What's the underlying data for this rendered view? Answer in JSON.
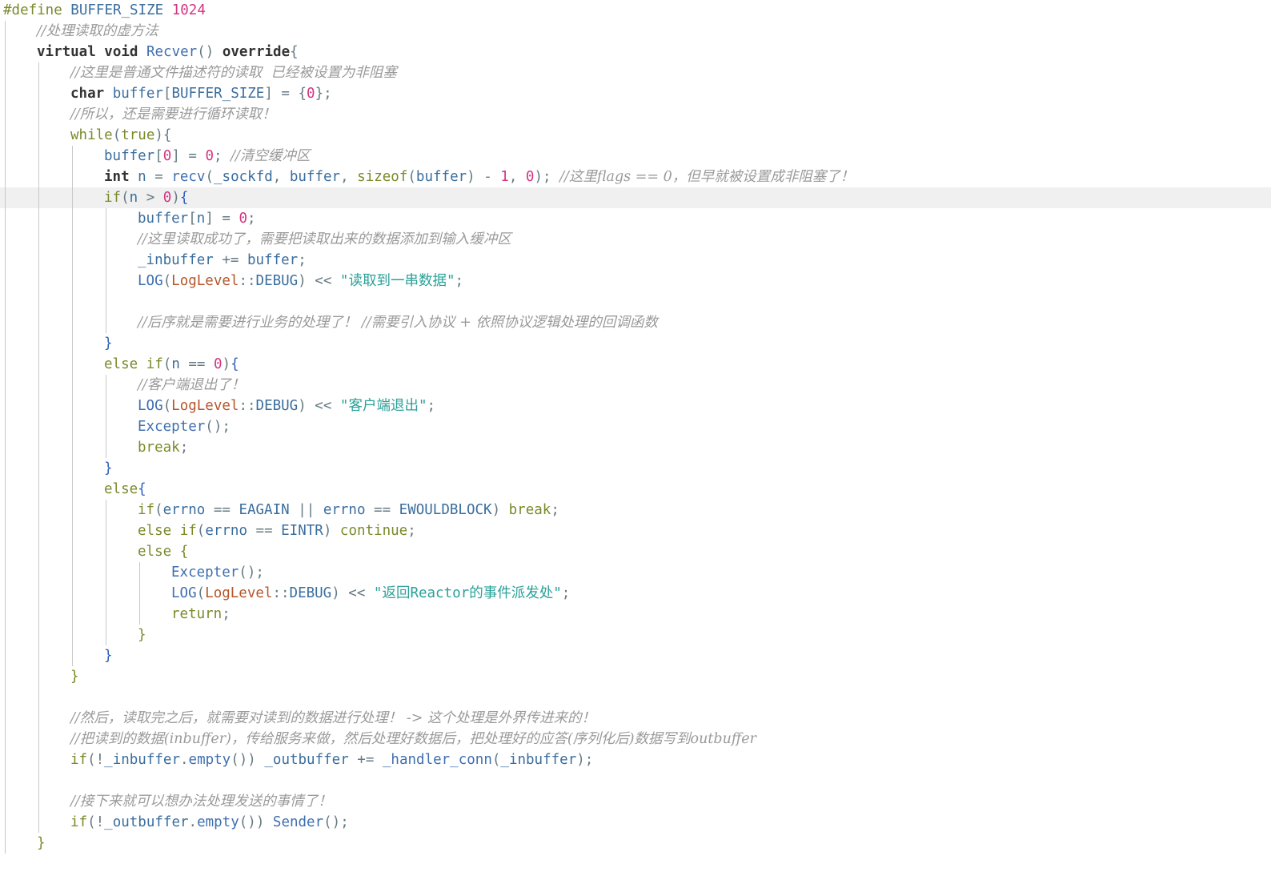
{
  "editor": {
    "language": "cpp",
    "current_line": 9,
    "colors": {
      "background": "#ffffff",
      "current_line": "#f0f0f0",
      "comment": "#9a9a9a",
      "keyword": "#7a8a2a",
      "function": "#3f6fb0",
      "number": "#d33682",
      "string": "#2aa198",
      "class": "#b5562b"
    },
    "lines": [
      {
        "indent": 0,
        "tokens": [
          [
            "k",
            "#define "
          ],
          [
            "v",
            "BUFFER_SIZE "
          ],
          [
            "n",
            "1024"
          ]
        ]
      },
      {
        "indent": 1,
        "tokens": [
          [
            "c",
            "//处理读取的虚方法"
          ]
        ]
      },
      {
        "indent": 1,
        "tokens": [
          [
            "kb",
            "virtual "
          ],
          [
            "kb",
            "void "
          ],
          [
            "f",
            "Recver"
          ],
          [
            "o",
            "() "
          ],
          [
            "kb",
            "override"
          ],
          [
            "o",
            "{"
          ]
        ]
      },
      {
        "indent": 2,
        "tokens": [
          [
            "c",
            "//这里是普通文件描述符的读取  已经被设置为非阻塞"
          ]
        ]
      },
      {
        "indent": 2,
        "tokens": [
          [
            "t",
            "char "
          ],
          [
            "v",
            "buffer"
          ],
          [
            "o",
            "["
          ],
          [
            "v",
            "BUFFER_SIZE"
          ],
          [
            "o",
            "] = {"
          ],
          [
            "n",
            "0"
          ],
          [
            "o",
            "};"
          ]
        ]
      },
      {
        "indent": 2,
        "tokens": [
          [
            "c",
            "//所以，还是需要进行循环读取！"
          ]
        ]
      },
      {
        "indent": 2,
        "tokens": [
          [
            "k",
            "while"
          ],
          [
            "o",
            "("
          ],
          [
            "k",
            "true"
          ],
          [
            "o",
            "){"
          ]
        ]
      },
      {
        "indent": 3,
        "tokens": [
          [
            "v",
            "buffer"
          ],
          [
            "o",
            "["
          ],
          [
            "n",
            "0"
          ],
          [
            "o",
            "] = "
          ],
          [
            "n",
            "0"
          ],
          [
            "o",
            "; "
          ],
          [
            "c",
            "//清空缓冲区"
          ]
        ]
      },
      {
        "indent": 3,
        "tokens": [
          [
            "t",
            "int "
          ],
          [
            "v",
            "n "
          ],
          [
            "o",
            "= "
          ],
          [
            "f",
            "recv"
          ],
          [
            "o",
            "("
          ],
          [
            "v",
            "_sockfd"
          ],
          [
            "o",
            ", "
          ],
          [
            "v",
            "buffer"
          ],
          [
            "o",
            ", "
          ],
          [
            "k",
            "sizeof"
          ],
          [
            "o",
            "("
          ],
          [
            "v",
            "buffer"
          ],
          [
            "o",
            ") - "
          ],
          [
            "n",
            "1"
          ],
          [
            "o",
            ", "
          ],
          [
            "n",
            "0"
          ],
          [
            "o",
            "); "
          ],
          [
            "c",
            "//这里flags == 0，但早就被设置成非阻塞了！"
          ]
        ]
      },
      {
        "indent": 3,
        "tokens": [
          [
            "k",
            "if"
          ],
          [
            "o",
            "("
          ],
          [
            "v",
            "n "
          ],
          [
            "o",
            "> "
          ],
          [
            "n",
            "0"
          ],
          [
            "o",
            ")"
          ],
          [
            "b",
            "{"
          ]
        ]
      },
      {
        "indent": 4,
        "tokens": [
          [
            "v",
            "buffer"
          ],
          [
            "o",
            "["
          ],
          [
            "v",
            "n"
          ],
          [
            "o",
            "] = "
          ],
          [
            "n",
            "0"
          ],
          [
            "o",
            ";"
          ]
        ]
      },
      {
        "indent": 4,
        "tokens": [
          [
            "c",
            "//这里读取成功了，需要把读取出来的数据添加到输入缓冲区"
          ]
        ]
      },
      {
        "indent": 4,
        "tokens": [
          [
            "v",
            "_inbuffer "
          ],
          [
            "o",
            "+= "
          ],
          [
            "v",
            "buffer"
          ],
          [
            "o",
            ";"
          ]
        ]
      },
      {
        "indent": 4,
        "tokens": [
          [
            "f",
            "LOG"
          ],
          [
            "o",
            "("
          ],
          [
            "cl",
            "LogLevel"
          ],
          [
            "o",
            "::"
          ],
          [
            "v",
            "DEBUG"
          ],
          [
            "o",
            ") << "
          ],
          [
            "s",
            "\"读取到一串数据\""
          ],
          [
            "o",
            ";"
          ]
        ]
      },
      {
        "indent": 4,
        "tokens": []
      },
      {
        "indent": 4,
        "tokens": [
          [
            "c",
            "//后序就是需要进行业务的处理了！ //需要引入协议 + 依照协议逻辑处理的回调函数"
          ]
        ]
      },
      {
        "indent": 3,
        "tokens": [
          [
            "b",
            "}"
          ]
        ]
      },
      {
        "indent": 3,
        "tokens": [
          [
            "k",
            "else "
          ],
          [
            "k",
            "if"
          ],
          [
            "o",
            "("
          ],
          [
            "v",
            "n "
          ],
          [
            "o",
            "== "
          ],
          [
            "n",
            "0"
          ],
          [
            "o",
            ")"
          ],
          [
            "b",
            "{"
          ]
        ]
      },
      {
        "indent": 4,
        "tokens": [
          [
            "c",
            "//客户端退出了！"
          ]
        ]
      },
      {
        "indent": 4,
        "tokens": [
          [
            "f",
            "LOG"
          ],
          [
            "o",
            "("
          ],
          [
            "cl",
            "LogLevel"
          ],
          [
            "o",
            "::"
          ],
          [
            "v",
            "DEBUG"
          ],
          [
            "o",
            ") << "
          ],
          [
            "s",
            "\"客户端退出\""
          ],
          [
            "o",
            ";"
          ]
        ]
      },
      {
        "indent": 4,
        "tokens": [
          [
            "f",
            "Excepter"
          ],
          [
            "o",
            "();"
          ]
        ]
      },
      {
        "indent": 4,
        "tokens": [
          [
            "k",
            "break"
          ],
          [
            "o",
            ";"
          ]
        ]
      },
      {
        "indent": 3,
        "tokens": [
          [
            "b",
            "}"
          ]
        ]
      },
      {
        "indent": 3,
        "tokens": [
          [
            "k",
            "else"
          ],
          [
            "b",
            "{"
          ]
        ]
      },
      {
        "indent": 4,
        "tokens": [
          [
            "k",
            "if"
          ],
          [
            "o",
            "("
          ],
          [
            "v",
            "errno "
          ],
          [
            "o",
            "== "
          ],
          [
            "v",
            "EAGAIN "
          ],
          [
            "o",
            "|| "
          ],
          [
            "v",
            "errno "
          ],
          [
            "o",
            "== "
          ],
          [
            "v",
            "EWOULDBLOCK"
          ],
          [
            "o",
            ") "
          ],
          [
            "k",
            "break"
          ],
          [
            "o",
            ";"
          ]
        ]
      },
      {
        "indent": 4,
        "tokens": [
          [
            "k",
            "else "
          ],
          [
            "k",
            "if"
          ],
          [
            "o",
            "("
          ],
          [
            "v",
            "errno "
          ],
          [
            "o",
            "== "
          ],
          [
            "v",
            "EINTR"
          ],
          [
            "o",
            ") "
          ],
          [
            "k",
            "continue"
          ],
          [
            "o",
            ";"
          ]
        ]
      },
      {
        "indent": 4,
        "tokens": [
          [
            "k",
            "else "
          ],
          [
            "k",
            "{"
          ]
        ]
      },
      {
        "indent": 5,
        "tokens": [
          [
            "f",
            "Excepter"
          ],
          [
            "o",
            "();"
          ]
        ]
      },
      {
        "indent": 5,
        "tokens": [
          [
            "f",
            "LOG"
          ],
          [
            "o",
            "("
          ],
          [
            "cl",
            "LogLevel"
          ],
          [
            "o",
            "::"
          ],
          [
            "v",
            "DEBUG"
          ],
          [
            "o",
            ") << "
          ],
          [
            "s",
            "\"返回Reactor的事件派发处\""
          ],
          [
            "o",
            ";"
          ]
        ]
      },
      {
        "indent": 5,
        "tokens": [
          [
            "k",
            "return"
          ],
          [
            "o",
            ";"
          ]
        ]
      },
      {
        "indent": 4,
        "tokens": [
          [
            "k",
            "}"
          ]
        ]
      },
      {
        "indent": 3,
        "tokens": [
          [
            "b",
            "}"
          ]
        ]
      },
      {
        "indent": 2,
        "tokens": [
          [
            "k",
            "}"
          ]
        ]
      },
      {
        "indent": 2,
        "tokens": []
      },
      {
        "indent": 2,
        "tokens": [
          [
            "c",
            "//然后，读取完之后，就需要对读到的数据进行处理！ -> 这个处理是外界传进来的！"
          ]
        ]
      },
      {
        "indent": 2,
        "tokens": [
          [
            "c",
            "//把读到的数据(inbuffer)，传给服务来做，然后处理好数据后，把处理好的应答(序列化后)数据写到outbuffer"
          ]
        ]
      },
      {
        "indent": 2,
        "tokens": [
          [
            "k",
            "if"
          ],
          [
            "o",
            "(!"
          ],
          [
            "v",
            "_inbuffer"
          ],
          [
            "o",
            "."
          ],
          [
            "f",
            "empty"
          ],
          [
            "o",
            "()) "
          ],
          [
            "v",
            "_outbuffer "
          ],
          [
            "o",
            "+= "
          ],
          [
            "f",
            "_handler_conn"
          ],
          [
            "o",
            "("
          ],
          [
            "v",
            "_inbuffer"
          ],
          [
            "o",
            ");"
          ]
        ]
      },
      {
        "indent": 2,
        "tokens": []
      },
      {
        "indent": 2,
        "tokens": [
          [
            "c",
            "//接下来就可以想办法处理发送的事情了！"
          ]
        ]
      },
      {
        "indent": 2,
        "tokens": [
          [
            "k",
            "if"
          ],
          [
            "o",
            "(!"
          ],
          [
            "v",
            "_outbuffer"
          ],
          [
            "o",
            "."
          ],
          [
            "f",
            "empty"
          ],
          [
            "o",
            "()) "
          ],
          [
            "f",
            "Sender"
          ],
          [
            "o",
            "();"
          ]
        ]
      },
      {
        "indent": 1,
        "tokens": [
          [
            "k",
            "}"
          ]
        ]
      }
    ]
  }
}
